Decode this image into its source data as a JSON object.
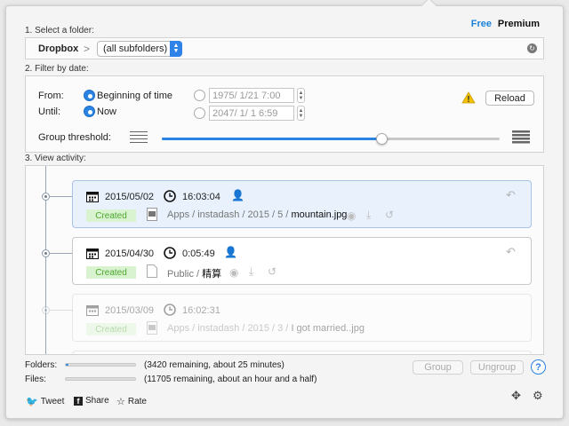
{
  "plans": {
    "free": "Free",
    "premium": "Premium"
  },
  "folder": {
    "section_label": "1. Select a folder:",
    "root": "Dropbox",
    "separator": ">",
    "selected": "(all subfolders)"
  },
  "filter": {
    "section_label": "2. Filter by date:",
    "from_label": "From:",
    "until_label": "Until:",
    "from_option": "Beginning of time",
    "until_option": "Now",
    "from_date": "1975/  1/21   7:00",
    "until_date": "2047/  1/  1   6:59",
    "reload_label": "Reload",
    "threshold_label": "Group threshold:",
    "threshold_value": 0.65
  },
  "activity": {
    "section_label": "3. View activity:",
    "items": [
      {
        "date": "2015/05/02",
        "time": "16:03:04",
        "tag": "Created",
        "path": "Apps / instadash / 2015 / 5 / ",
        "file": "mountain.jpg"
      },
      {
        "date": "2015/04/30",
        "time": "0:05:49",
        "tag": "Created",
        "path": "Public / ",
        "file": "精算"
      },
      {
        "date": "2015/03/09",
        "time": "16:02:31",
        "tag": "Created",
        "path": "Apps / instadash / 2015 / 3 / ",
        "file": "I got married..jpg"
      }
    ]
  },
  "progress": {
    "folders_label": "Folders:",
    "folders_status": "(3420 remaining, about 25 minutes)",
    "folders_value": 0.04,
    "files_label": "Files:",
    "files_status": "(11705 remaining, about an hour and a half)",
    "files_value": 0.0
  },
  "buttons": {
    "group": "Group",
    "ungroup": "Ungroup",
    "help": "?"
  },
  "share": {
    "tweet": "Tweet",
    "share": "Share",
    "rate": "Rate"
  },
  "colors": {
    "accent": "#2a82e2",
    "created_bg": "#d9f2cf",
    "created_text": "#4aa82e",
    "warning": "#f2c200"
  }
}
